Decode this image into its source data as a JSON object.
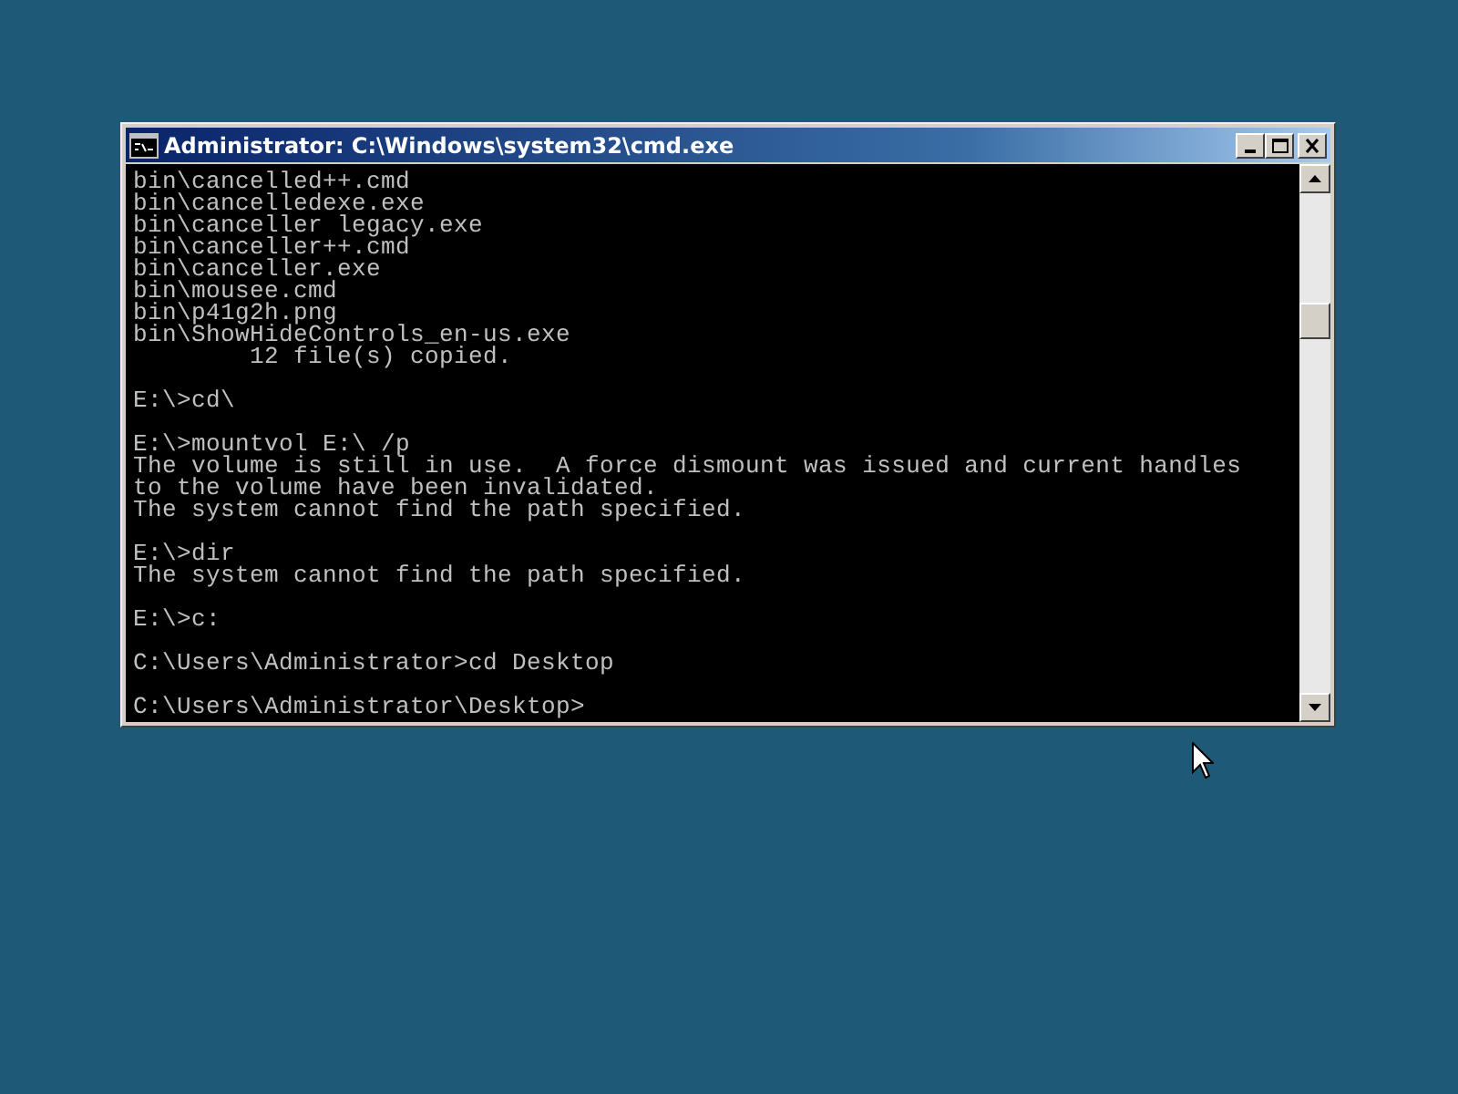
{
  "window": {
    "title": "Administrator: C:\\Windows\\system32\\cmd.exe",
    "buttons": [
      {
        "kind": "minimize"
      },
      {
        "kind": "maximize"
      },
      {
        "kind": "close"
      }
    ]
  },
  "console": {
    "blocks": [
      [
        "bin\\cancelled++.cmd",
        "bin\\cancelledexe.exe",
        "bin\\canceller legacy.exe",
        "bin\\canceller++.cmd",
        "bin\\canceller.exe",
        "bin\\mousee.cmd",
        "bin\\p41g2h.png",
        "bin\\ShowHideControls_en-us.exe",
        "        12 file(s) copied."
      ],
      [
        "E:\\>cd\\"
      ],
      [
        "E:\\>mountvol E:\\ /p",
        "The volume is still in use.  A force dismount was issued and current handles",
        "to the volume have been invalidated.",
        "The system cannot find the path specified."
      ],
      [
        "E:\\>dir",
        "The system cannot find the path specified."
      ],
      [
        "E:\\>c:"
      ],
      [
        "C:\\Users\\Administrator>cd Desktop"
      ],
      [
        "C:\\Users\\Administrator\\Desktop>"
      ]
    ]
  }
}
